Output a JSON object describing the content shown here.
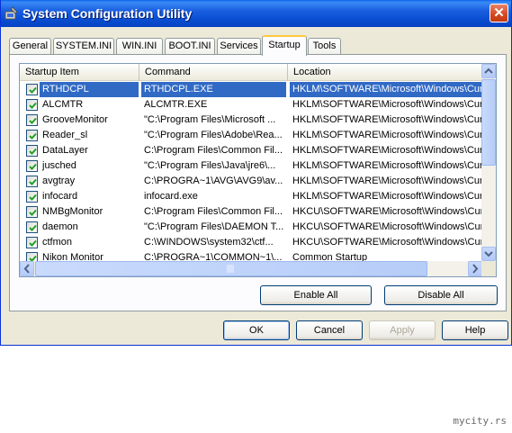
{
  "window": {
    "title": "System Configuration Utility"
  },
  "tabs": [
    {
      "label": "General"
    },
    {
      "label": "SYSTEM.INI"
    },
    {
      "label": "WIN.INI"
    },
    {
      "label": "BOOT.INI"
    },
    {
      "label": "Services"
    },
    {
      "label": "Startup"
    },
    {
      "label": "Tools"
    }
  ],
  "active_tab": "Startup",
  "startup_list": {
    "columns": [
      "Startup Item",
      "Command",
      "Location"
    ],
    "rows": [
      {
        "checked": true,
        "item": "RTHDCPL",
        "command": "RTHDCPL.EXE",
        "location": "HKLM\\SOFTWARE\\Microsoft\\Windows\\Curre"
      },
      {
        "checked": true,
        "item": "ALCMTR",
        "command": "ALCMTR.EXE",
        "location": "HKLM\\SOFTWARE\\Microsoft\\Windows\\Curre"
      },
      {
        "checked": true,
        "item": "GrooveMonitor",
        "command": "\"C:\\Program Files\\Microsoft ...",
        "location": "HKLM\\SOFTWARE\\Microsoft\\Windows\\Curre"
      },
      {
        "checked": true,
        "item": "Reader_sl",
        "command": "\"C:\\Program Files\\Adobe\\Rea...",
        "location": "HKLM\\SOFTWARE\\Microsoft\\Windows\\Curre"
      },
      {
        "checked": true,
        "item": "DataLayer",
        "command": "C:\\Program Files\\Common Fil...",
        "location": "HKLM\\SOFTWARE\\Microsoft\\Windows\\Curre"
      },
      {
        "checked": true,
        "item": "jusched",
        "command": "\"C:\\Program Files\\Java\\jre6\\...",
        "location": "HKLM\\SOFTWARE\\Microsoft\\Windows\\Curre"
      },
      {
        "checked": true,
        "item": "avgtray",
        "command": "C:\\PROGRA~1\\AVG\\AVG9\\av...",
        "location": "HKLM\\SOFTWARE\\Microsoft\\Windows\\Curre"
      },
      {
        "checked": true,
        "item": "infocard",
        "command": "infocard.exe",
        "location": "HKLM\\SOFTWARE\\Microsoft\\Windows\\Curre"
      },
      {
        "checked": true,
        "item": "NMBgMonitor",
        "command": "C:\\Program Files\\Common Fil...",
        "location": "HKCU\\SOFTWARE\\Microsoft\\Windows\\Curre"
      },
      {
        "checked": true,
        "item": "daemon",
        "command": "\"C:\\Program Files\\DAEMON T...",
        "location": "HKCU\\SOFTWARE\\Microsoft\\Windows\\Curre"
      },
      {
        "checked": true,
        "item": "ctfmon",
        "command": "C:\\WINDOWS\\system32\\ctf...",
        "location": "HKCU\\SOFTWARE\\Microsoft\\Windows\\Curre"
      },
      {
        "checked": true,
        "item": "Nikon Monitor",
        "command": "C:\\PROGRA~1\\COMMON~1\\...",
        "location": "Common Startup"
      }
    ],
    "selected_index": 0
  },
  "actions": {
    "enable_all": "Enable All",
    "disable_all": "Disable All"
  },
  "dialog_buttons": {
    "ok": "OK",
    "cancel": "Cancel",
    "apply": "Apply",
    "help": "Help"
  },
  "watermark": "mycity.rs",
  "colors": {
    "titlebar": "#0a4fd3",
    "selection": "#316ac5",
    "active_tab_accent": "#ffc83c",
    "check": "#21a121"
  },
  "icons": {
    "title": "msconfig-icon",
    "close": "close-icon",
    "checkbox": "checkmark-icon"
  }
}
